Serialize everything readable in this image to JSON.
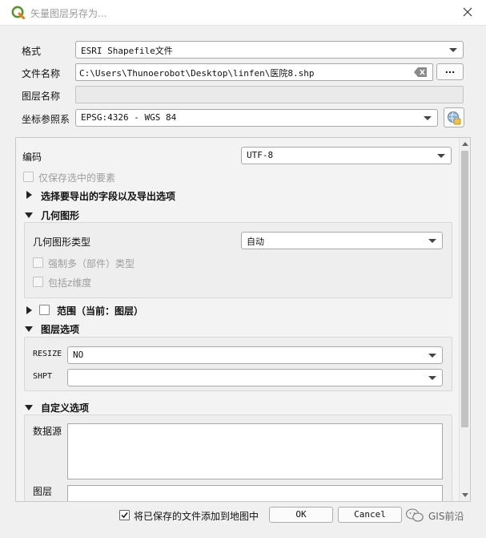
{
  "window": {
    "title": "矢量图层另存为..."
  },
  "form": {
    "format_label": "格式",
    "format_value": "ESRI Shapefile文件",
    "filename_label": "文件名称",
    "filename_value": "C:\\Users\\Thunoerobot\\Desktop\\linfen\\医院8.shp",
    "browse_label": "...",
    "layername_label": "图层名称",
    "layername_value": "",
    "crs_label": "坐标参照系",
    "crs_value": "EPSG:4326 - WGS 84"
  },
  "panel": {
    "encoding_label": "编码",
    "encoding_value": "UTF-8",
    "save_selected_label": "仅保存选中的要素",
    "select_fields_label": "选择要导出的字段以及导出选项",
    "geometry": {
      "title": "几何图形",
      "type_label": "几何图形类型",
      "type_value": "自动",
      "force_multi_label": "强制多（部件）类型",
      "include_z_label": "包括z维度"
    },
    "extent_label": "范围（当前：图层）",
    "layer_options": {
      "title": "图层选项",
      "resize_label": "RESIZE",
      "resize_value": "NO",
      "shpt_label": "SHPT",
      "shpt_value": ""
    },
    "custom_options": {
      "title": "自定义选项",
      "datasource_label": "数据源",
      "layer_label": "图层"
    }
  },
  "footer": {
    "add_to_map_label": "将已保存的文件添加到地图中",
    "ok_label": "OK",
    "cancel_label": "Cancel",
    "watermark_text": "GIS前沿"
  }
}
